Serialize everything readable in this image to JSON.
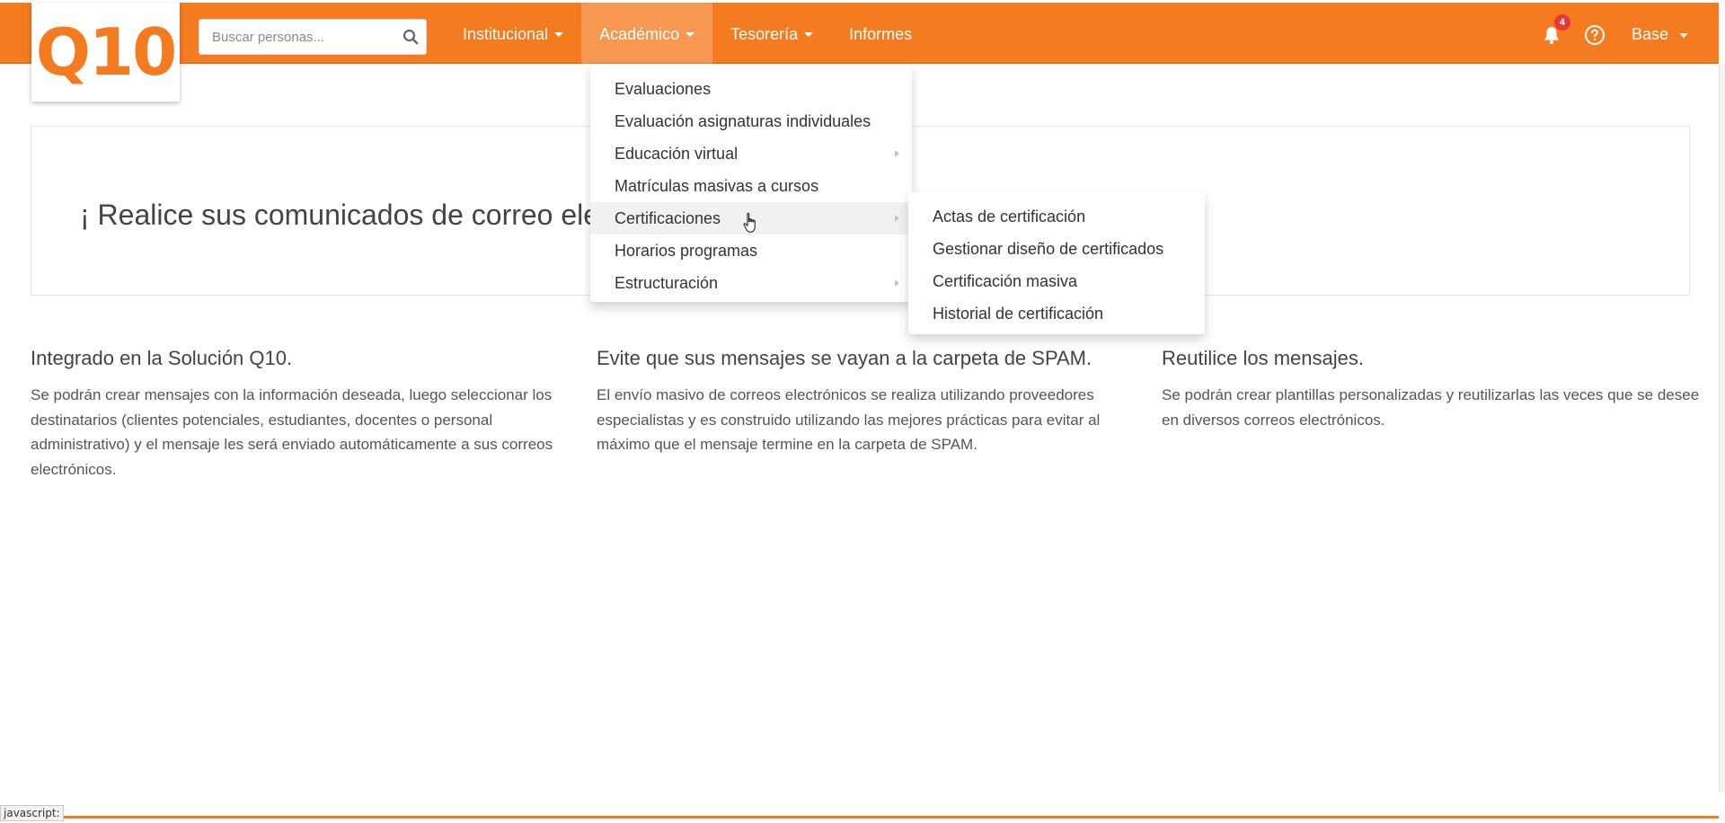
{
  "header": {
    "logo_text": "Q10",
    "search": {
      "placeholder": "Buscar personas..."
    },
    "nav": [
      {
        "label": "Institucional",
        "dropdown": true
      },
      {
        "label": "Académico",
        "dropdown": true,
        "active": true
      },
      {
        "label": "Tesorería",
        "dropdown": true
      },
      {
        "label": "Informes",
        "dropdown": false
      }
    ],
    "notifications_count": "4",
    "user_label": "Base"
  },
  "academico_menu": [
    {
      "label": "Evaluaciones",
      "has_submenu": false
    },
    {
      "label": "Evaluación asignaturas individuales",
      "has_submenu": false
    },
    {
      "label": "Educación virtual",
      "has_submenu": true
    },
    {
      "label": "Matrículas masivas a cursos",
      "has_submenu": false
    },
    {
      "label": "Certificaciones",
      "has_submenu": true,
      "hovered": true
    },
    {
      "label": "Horarios programas",
      "has_submenu": false
    },
    {
      "label": "Estructuración",
      "has_submenu": true
    }
  ],
  "certificaciones_submenu": [
    {
      "label": "Actas de certificación"
    },
    {
      "label": "Gestionar diseño de certificados"
    },
    {
      "label": "Certificación masiva"
    },
    {
      "label": "Historial de certificación"
    }
  ],
  "banner": {
    "text": "¡ Realice sus comunicados de correo ele"
  },
  "features": [
    {
      "title": "Integrado en la Solución Q10.",
      "body": "Se podrán crear mensajes con la información deseada, luego seleccionar los destinatarios (clientes potenciales, estudiantes, docentes o personal administrativo) y el mensaje les será enviado automáticamente a sus correos electrónicos."
    },
    {
      "title": "Evite que sus mensajes se vayan a la carpeta de SPAM.",
      "body": "El envío masivo de correos electrónicos se realiza utilizando proveedores especialistas y es construido utilizando las mejores prácticas para evitar al máximo que el mensaje termine en la carpeta de SPAM."
    },
    {
      "title": "Reutilice los mensajes.",
      "body": "Se podrán crear plantillas personalizadas y reutilizarlas las veces que se desee en diversos correos electrónicos."
    }
  ],
  "status_bar": {
    "text": "javascript:"
  },
  "colors": {
    "brand": "#f47b20",
    "badge": "#e53935"
  },
  "icons": {
    "search": "search-icon",
    "bell": "bell-icon",
    "help": "help-icon",
    "cursor": "hand-pointer-icon"
  }
}
